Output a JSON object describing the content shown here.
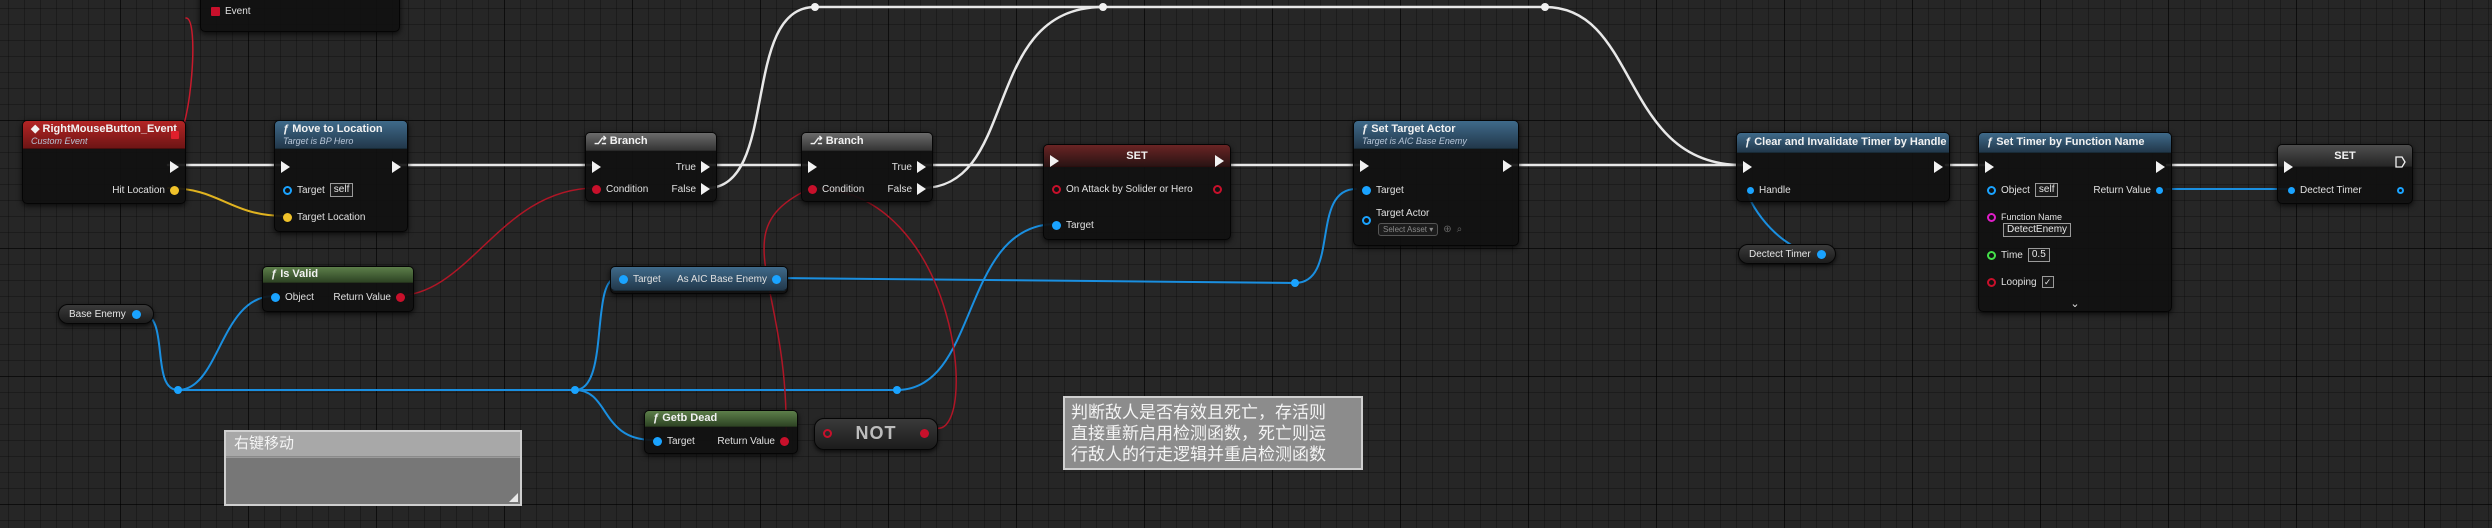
{
  "nodes": {
    "event_pin": {
      "label": "Event"
    },
    "rmb": {
      "title": "RightMouseButton_Event",
      "subtitle": "Custom Event",
      "out_hit": "Hit Location"
    },
    "move": {
      "title": "Move to Location",
      "subtitle": "Target is BP Hero",
      "target": "Target",
      "self_value": "self",
      "target_location": "Target Location"
    },
    "branch1": {
      "title": "Branch",
      "condition": "Condition",
      "true_label": "True",
      "false_label": "False"
    },
    "branch2": {
      "title": "Branch",
      "condition": "Condition",
      "true_label": "True",
      "false_label": "False"
    },
    "set1": {
      "title": "SET",
      "variable": "On Attack by Solider or Hero",
      "target": "Target"
    },
    "set_target": {
      "title": "Set Target Actor",
      "subtitle": "Target is AIC Base Enemy",
      "target": "Target",
      "target_actor": "Target Actor",
      "select_asset": "Select Asset"
    },
    "is_valid": {
      "title": "Is Valid",
      "object": "Object",
      "return_value": "Return Value"
    },
    "cast": {
      "target": "Target",
      "output": "As AIC Base Enemy"
    },
    "base_enemy": {
      "label": "Base Enemy"
    },
    "get_dead": {
      "title": "Getb Dead",
      "target": "Target",
      "return_value": "Return Value"
    },
    "not": {
      "label": "NOT"
    },
    "clear_timer": {
      "title": "Clear and Invalidate Timer by Handle",
      "handle": "Handle"
    },
    "detect_var": {
      "label": "Dectect Timer"
    },
    "set_timer": {
      "title": "Set Timer by Function Name",
      "object": "Object",
      "self_value": "self",
      "return_value": "Return Value",
      "function_name": "Function Name",
      "function_value": "DetectEnemy",
      "time": "Time",
      "time_value": "0.5",
      "looping": "Looping",
      "looping_check": "✓",
      "expand": "⌄"
    },
    "set2": {
      "title": "SET",
      "variable": "Dectect Timer"
    }
  },
  "comments": {
    "right_click": {
      "title": "右键移动"
    },
    "note": {
      "text": "判断敌人是否有效且死亡，存活则\n直接重新启用检测函数，死亡则运\n行敌人的行走逻辑并重启检测函数"
    }
  },
  "icons": {
    "event": "event-diamond-icon",
    "function": "function-f-icon",
    "branch": "branch-icon"
  },
  "colors": {
    "exec": "#f2f2f2",
    "object_pin": "#1aa3ff",
    "bool_pin": "#c8102b",
    "vector_pin": "#f0c22a",
    "float_pin": "#44e04a",
    "name_pin": "#e01ec8"
  }
}
